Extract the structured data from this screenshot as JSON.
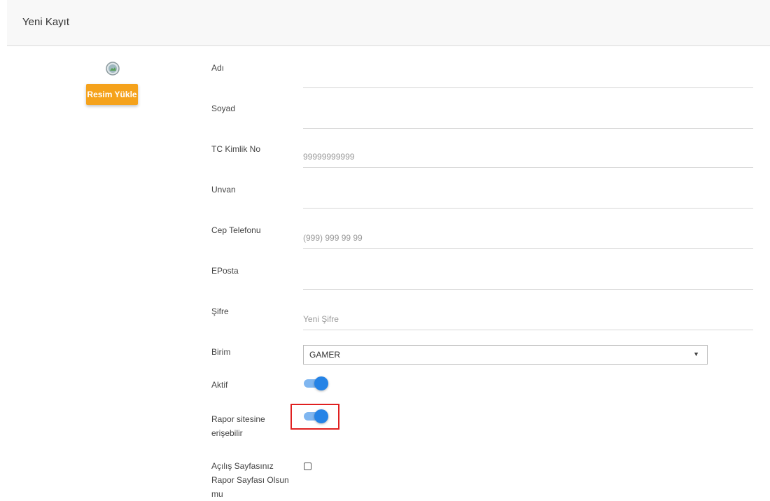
{
  "header": {
    "title": "Yeni Kayıt"
  },
  "photo": {
    "upload_label": "Resim Yükle"
  },
  "fields": {
    "ad": {
      "label": "Adı",
      "value": "",
      "placeholder": ""
    },
    "soyad": {
      "label": "Soyad",
      "value": "",
      "placeholder": ""
    },
    "tc": {
      "label": "TC Kimlik No",
      "value": "",
      "placeholder": "99999999999"
    },
    "unvan": {
      "label": "Unvan",
      "value": "",
      "placeholder": ""
    },
    "cep": {
      "label": "Cep Telefonu",
      "value": "",
      "placeholder": "(999) 999 99 99"
    },
    "eposta": {
      "label": "EPosta",
      "value": "",
      "placeholder": ""
    },
    "sifre": {
      "label": "Şifre",
      "value": "",
      "placeholder": "Yeni Şifre"
    }
  },
  "birim": {
    "label": "Birim",
    "selected": "GAMER"
  },
  "aktif": {
    "label": "Aktif",
    "on": true
  },
  "rapor": {
    "label_line1": "Rapor sitesine",
    "label_line2": "erişebilir",
    "on": true
  },
  "acilis": {
    "label_line1": "Açılış Sayfasınız",
    "label_line2": "Rapor Sayfası Olsun",
    "label_line3": "mu",
    "checked": false
  },
  "colors": {
    "upload_button": "#f5a21b",
    "toggle_knob": "#2583e6",
    "toggle_track": "#7fb6f0",
    "highlight": "#e02020"
  },
  "icons": {
    "avatar": "image-placeholder-icon",
    "dropdown": "caret-down-icon"
  }
}
